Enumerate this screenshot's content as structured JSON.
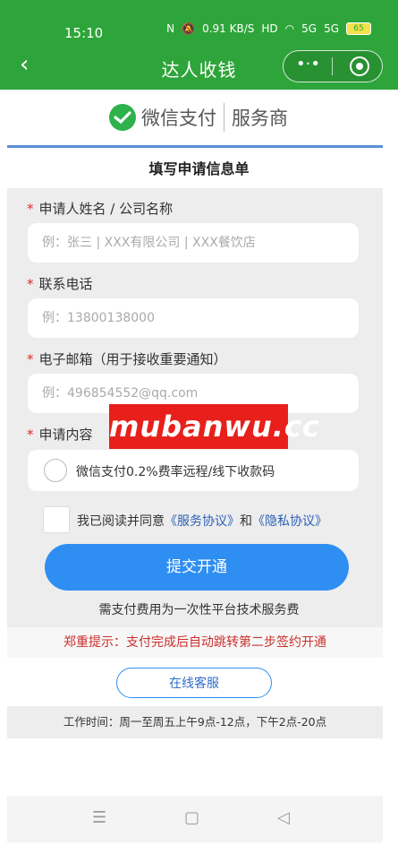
{
  "status": {
    "time": "15:10",
    "icons": [
      "N",
      "bell-off",
      "0.91 KB/S",
      "HD",
      "wifi",
      "5G",
      "5G"
    ],
    "battery": "65"
  },
  "header": {
    "title": "达人收钱",
    "more_label": "•·•"
  },
  "brand": {
    "wechat": "微信支付",
    "service": "服务商"
  },
  "form": {
    "title": "填写申请信息单",
    "required_mark": "*",
    "name_label": "申请人姓名 / 公司名称",
    "name_placeholder": "例：张三 | XXX有限公司 | XXX餐饮店",
    "phone_label": "联系电话",
    "phone_placeholder": "例：13800138000",
    "email_label": "电子邮箱（用于接收重要通知）",
    "email_placeholder": "例：496854552@qq.com",
    "content_label": "申请内容",
    "option_label": "微信支付0.2%费率远程/线下收款码",
    "agree_prefix": "我已阅读并同意",
    "service_agreement": "《服务协议》",
    "agree_and": "和",
    "privacy_agreement": "《隐私协议》",
    "submit_label": "提交开通",
    "fee_note": "需支付费用为一次性平台技术服务费"
  },
  "notice": "郑重提示：支付完成后自动跳转第二步签约开通",
  "support": {
    "button_label": "在线客服",
    "hours": "工作时间：周一至周五上午9点-12点，下午2点-20点"
  },
  "nav": {
    "menu": "☰",
    "home": "▢",
    "back": "◁"
  },
  "watermark": "mubanwu.cc",
  "colors": {
    "brand_green": "#2ea53a",
    "primary_blue": "#2f8ef2",
    "warning_red": "#c9302c"
  }
}
